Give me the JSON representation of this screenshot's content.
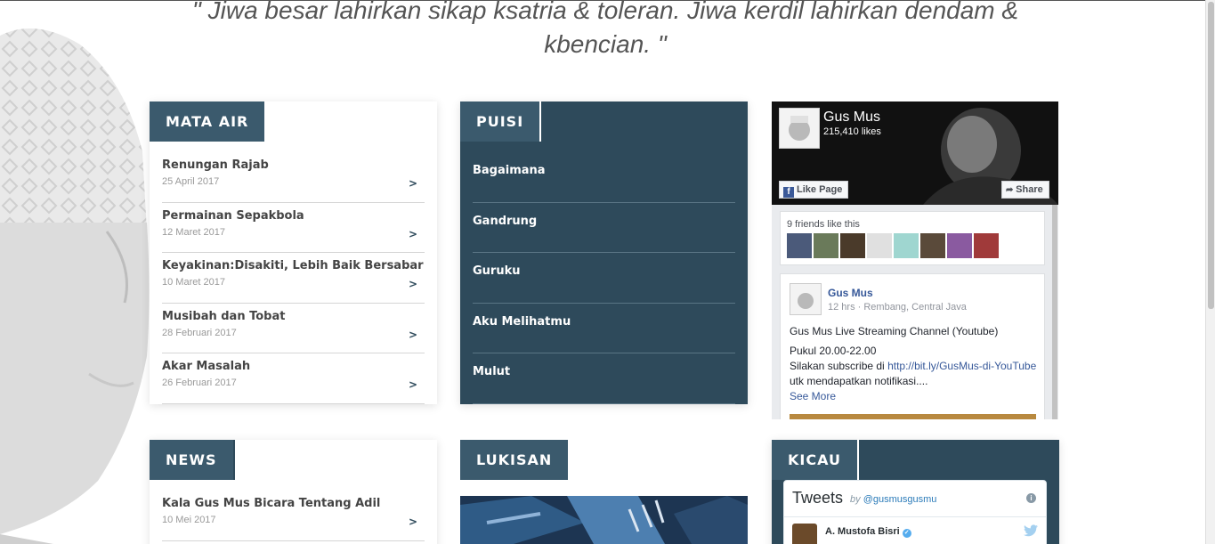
{
  "quote": {
    "text": "\" Jiwa besar lahirkan sikap ksatria & toleran. Jiwa kerdil lahirkan dendam & kbencian. \""
  },
  "mata_air": {
    "heading": "MATA AIR",
    "items": [
      {
        "title": "Renungan Rajab",
        "date": "25 April 2017",
        "arrow": ">"
      },
      {
        "title": "Permainan Sepakbola",
        "date": "12 Maret 2017",
        "arrow": ">"
      },
      {
        "title": "Keyakinan:Disakiti, Lebih Baik Bersabar",
        "date": "10 Maret 2017",
        "arrow": ">"
      },
      {
        "title": "Musibah dan Tobat",
        "date": "28 Februari 2017",
        "arrow": ">"
      },
      {
        "title": "Akar Masalah",
        "date": "26 Februari 2017",
        "arrow": ">"
      }
    ]
  },
  "puisi": {
    "heading": "PUISI",
    "items": [
      {
        "title": "Bagaimana"
      },
      {
        "title": "Gandrung"
      },
      {
        "title": "Guruku"
      },
      {
        "title": "Aku Melihatmu"
      },
      {
        "title": "Mulut"
      }
    ]
  },
  "facebook": {
    "page_name": "Gus Mus",
    "likes": "215,410 likes",
    "like_button": "Like Page",
    "share_button": "Share",
    "friends_text": "9 friends like this",
    "post": {
      "author": "Gus Mus",
      "meta": "12 hrs · Rembang, Central Java",
      "line1": "Gus Mus Live Streaming Channel (Youtube)",
      "line2": "Pukul 20.00-22.00",
      "line3_prefix": "Silakan subscribe di ",
      "link": "http://bit.ly/GusMus-di-YouTube",
      "line3_suffix": " utk mendapatkan notifikasi....",
      "see_more": "See More"
    }
  },
  "news": {
    "heading": "NEWS",
    "items": [
      {
        "title": "Kala Gus Mus Bicara Tentang Adil",
        "date": "10 Mei 2017",
        "arrow": ">"
      }
    ]
  },
  "lukisan": {
    "heading": "LUKISAN"
  },
  "kicau": {
    "heading": "KICAU",
    "widget_title": "Tweets",
    "by_prefix": "by",
    "handle": "@gusmusgusmu",
    "author": "A. Mustofa Bisri",
    "info_glyph": "i",
    "check_glyph": "✓",
    "bird_glyph": "🐦"
  },
  "colors": {
    "panel_dark": "#2e4a5b",
    "tab_bg": "#3b5a6d",
    "facebook_blue": "#365899",
    "twitter_blue": "#55acee"
  }
}
